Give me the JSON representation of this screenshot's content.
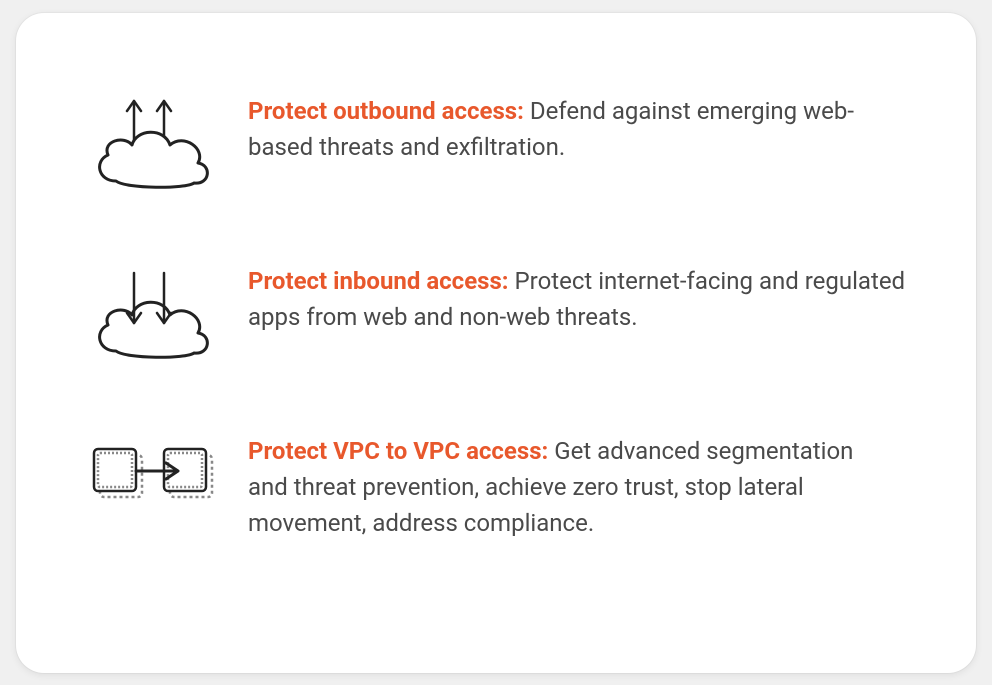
{
  "card": {
    "items": [
      {
        "title": "Protect outbound access:",
        "body": " Defend against emerging web-based threats and exfiltration."
      },
      {
        "title": "Protect inbound access:",
        "body": " Protect internet-facing and regulated apps from web and non-web threats."
      },
      {
        "title": "Protect VPC to VPC access:",
        "body": " Get advanced segmentation and threat prevention, achieve zero trust, stop lateral movement, address compliance."
      }
    ]
  },
  "colors": {
    "accent": "#e8582c",
    "text": "#4a4a4a",
    "card_bg": "#ffffff"
  }
}
